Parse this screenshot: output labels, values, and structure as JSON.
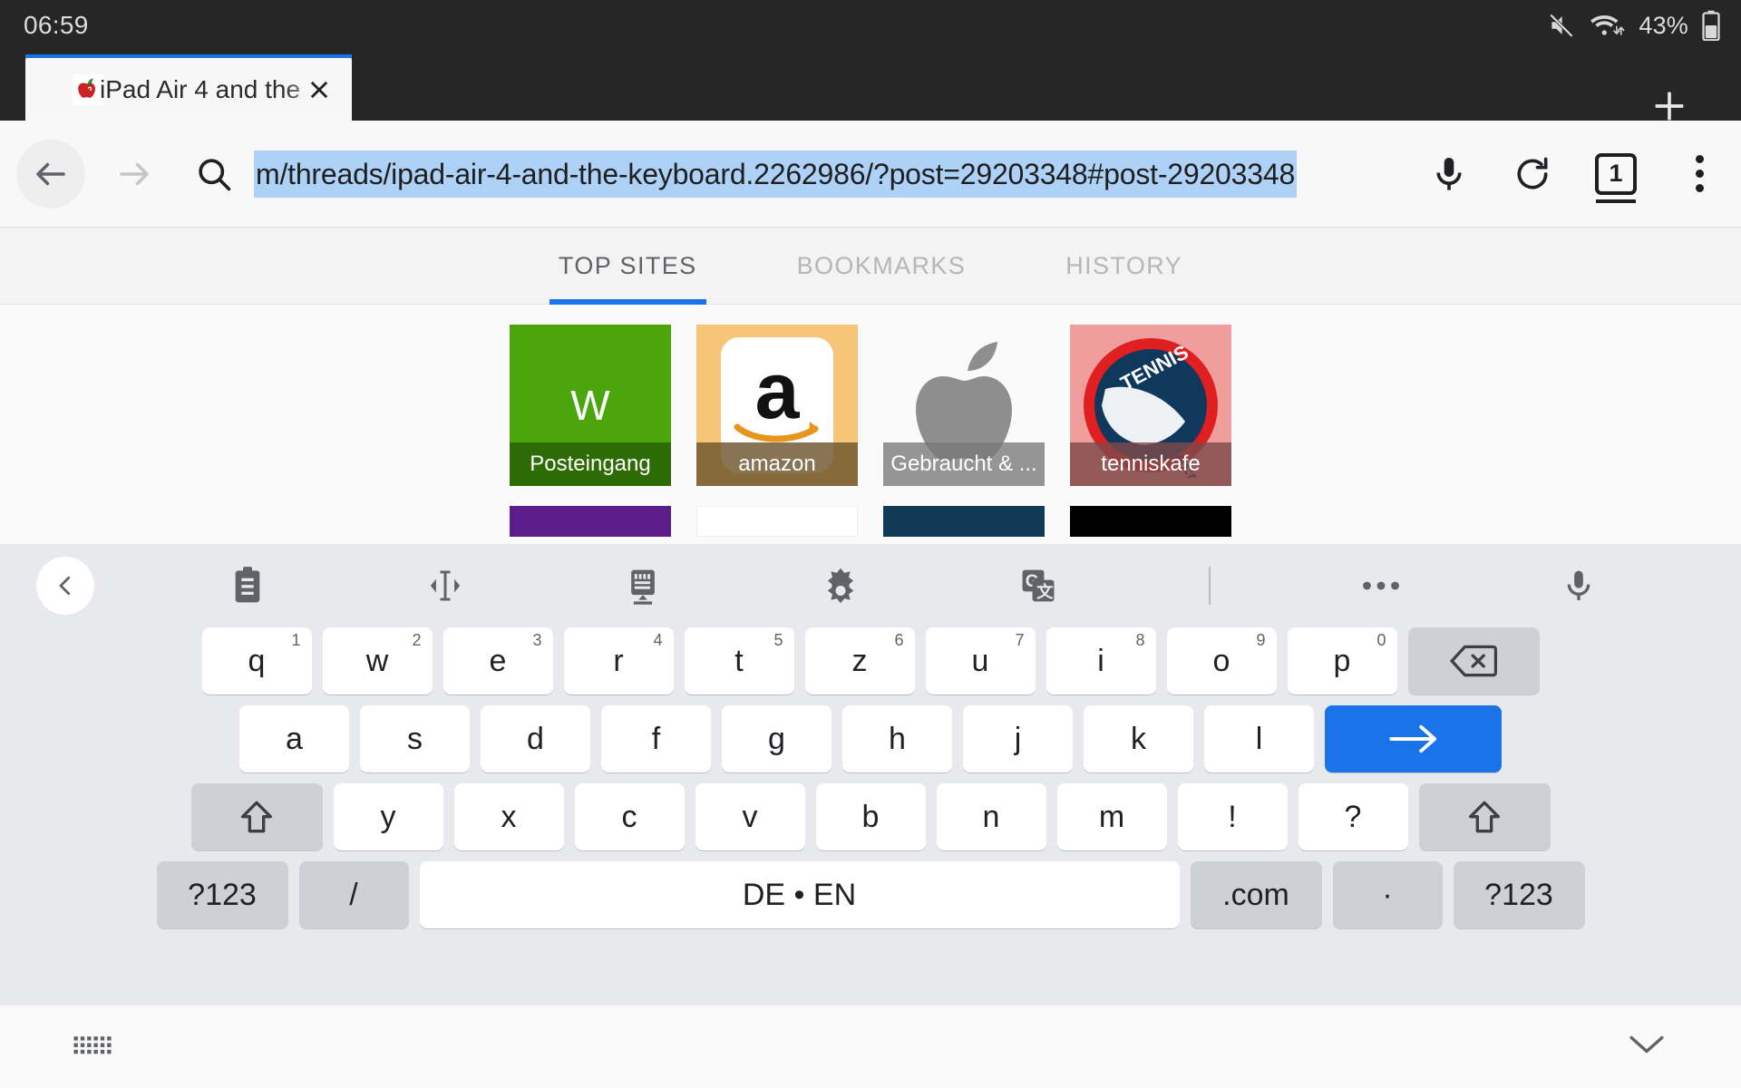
{
  "statusbar": {
    "clock": "06:59",
    "battery_percent": "43%",
    "icons": [
      "volume-mute-icon",
      "wifi-icon",
      "battery-icon"
    ]
  },
  "tabstrip": {
    "tab": {
      "title": "iPad Air 4 and the",
      "favicon": "apple-logo-red-icon",
      "close_label": "×"
    },
    "new_tab_label": "+"
  },
  "omnibox": {
    "back_icon": "arrow-back-icon",
    "forward_icon": "arrow-forward-icon",
    "search_icon": "search-icon",
    "url": "m/threads/ipad-air-4-and-the-keyboard.2262986/?post=29203348#post-29203348",
    "url_selected": true,
    "mic_icon": "microphone-icon",
    "reload_icon": "reload-icon",
    "tab_count": "1",
    "menu_icon": "overflow-menu-icon"
  },
  "newtabpage": {
    "tabs": [
      {
        "label": "TOP SITES",
        "active": true
      },
      {
        "label": "BOOKMARKS",
        "active": false
      },
      {
        "label": "HISTORY",
        "active": false
      }
    ],
    "tiles": [
      {
        "label": "Posteingang",
        "letter": "W",
        "bg": "#4ba50c",
        "label_bg": "#2e6b07",
        "kind": "letter"
      },
      {
        "label": "amazon",
        "bg": "#f7c577",
        "label_bg": "#8a6f3f",
        "kind": "amazon"
      },
      {
        "label": "Gebraucht & ...",
        "bg": "#fafafa",
        "label_bg": "#8f8f8f",
        "kind": "apple"
      },
      {
        "label": "tenniskafe",
        "bg": "#ef9d9d",
        "label_bg": "#7d4a4a",
        "kind": "tennis"
      }
    ],
    "tiles_row2": [
      {
        "bg": "#5b1d89"
      },
      {
        "bg": "#ffffff"
      },
      {
        "bg": "#123a57"
      },
      {
        "bg": "#000000"
      }
    ]
  },
  "keyboard": {
    "toolbar": [
      "chevron-left-icon",
      "clipboard-icon",
      "text-cursor-icon",
      "keyboard-switch-icon",
      "gear-icon",
      "google-translate-icon",
      "divider",
      "more-dots-icon",
      "microphone-icon"
    ],
    "row1": [
      {
        "key": "q",
        "sup": "1"
      },
      {
        "key": "w",
        "sup": "2"
      },
      {
        "key": "e",
        "sup": "3"
      },
      {
        "key": "r",
        "sup": "4"
      },
      {
        "key": "t",
        "sup": "5"
      },
      {
        "key": "z",
        "sup": "6"
      },
      {
        "key": "u",
        "sup": "7"
      },
      {
        "key": "i",
        "sup": "8"
      },
      {
        "key": "o",
        "sup": "9"
      },
      {
        "key": "p",
        "sup": "0"
      }
    ],
    "row1_extra": {
      "name": "backspace-key",
      "icon": "backspace-icon"
    },
    "row2": [
      "a",
      "s",
      "d",
      "f",
      "g",
      "h",
      "j",
      "k",
      "l"
    ],
    "row2_extra": {
      "name": "enter-key",
      "icon": "arrow-right-icon"
    },
    "row3_shift": {
      "name": "shift-key",
      "icon": "shift-icon"
    },
    "row3": [
      "y",
      "x",
      "c",
      "v",
      "b",
      "n",
      "m",
      "!",
      "?"
    ],
    "row3_shift_right": {
      "name": "shift-key-right",
      "icon": "shift-icon"
    },
    "row4": {
      "symbols_left": "?123",
      "slash": "/",
      "space": "DE • EN",
      "dotcom": ".com",
      "period": "·",
      "symbols_right": "?123"
    },
    "bottom": {
      "left_icon": "keyboard-resize-icon",
      "right_icon": "chevron-down-icon"
    }
  },
  "colors": {
    "accent": "#1a73e8",
    "status_bg": "#262626",
    "selection": "#aed2f7",
    "keyboard_bg": "#e7e9ec"
  }
}
